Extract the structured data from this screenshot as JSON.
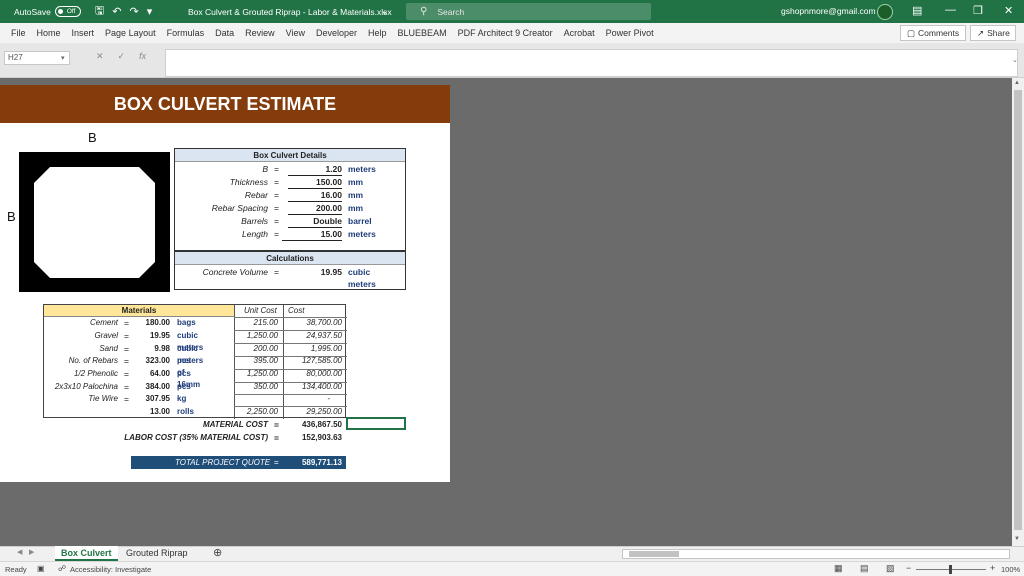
{
  "titlebar": {
    "autosave_label": "AutoSave",
    "autosave_state": "Off",
    "file_title": "Box Culvert & Grouted Riprap - Labor & Materials.xlsx",
    "search_placeholder": "Search",
    "user_email": "gshopnmore@gmail.com",
    "accent_color": "#217346"
  },
  "menu": {
    "items": [
      "File",
      "Home",
      "Insert",
      "Page Layout",
      "Formulas",
      "Data",
      "Review",
      "View",
      "Developer",
      "Help",
      "BLUEBEAM",
      "PDF Architect 9 Creator",
      "Acrobat",
      "Power Pivot"
    ],
    "comments_label": "Comments",
    "share_label": "Share"
  },
  "formula_bar": {
    "name_box": "H27",
    "fx_label": "fx",
    "value": ""
  },
  "sheet": {
    "title": "BOX CULVERT ESTIMATE",
    "title_color": "#843c0c",
    "diagram_label_top": "B",
    "diagram_label_left": "B",
    "details": {
      "header": "Box Culvert Details",
      "rows": [
        {
          "label": "B",
          "eq": "=",
          "value": "1.20",
          "unit": "meters"
        },
        {
          "label": "Thickness",
          "eq": "=",
          "value": "150.00",
          "unit": "mm"
        },
        {
          "label": "Rebar",
          "eq": "=",
          "value": "16.00",
          "unit": "mm"
        },
        {
          "label": "Rebar Spacing",
          "eq": "=",
          "value": "200.00",
          "unit": "mm"
        },
        {
          "label": "Barrels",
          "eq": "=",
          "value": "Double",
          "unit": "barrel"
        },
        {
          "label": "Length",
          "eq": "=",
          "value": "15.00",
          "unit": "meters"
        }
      ],
      "calc_header": "Calculations",
      "calc_label": "Concrete Volume",
      "calc_eq": "=",
      "calc_value": "19.95",
      "calc_unit": "cubic meters"
    },
    "materials": {
      "header": "Materials",
      "col_unit_cost": "Unit Cost",
      "col_cost": "Cost",
      "rows": [
        {
          "label": "Cement",
          "eq": "=",
          "qty": "180.00",
          "unit": "bags",
          "unit_cost": "215.00",
          "cost": "38,700.00"
        },
        {
          "label": "Gravel",
          "eq": "=",
          "qty": "19.95",
          "unit": "cubic meters",
          "unit_cost": "1,250.00",
          "cost": "24,937.50"
        },
        {
          "label": "Sand",
          "eq": "=",
          "qty": "9.98",
          "unit": "cubic meters",
          "unit_cost": "200.00",
          "cost": "1,995.00"
        },
        {
          "label": "No. of Rebars",
          "eq": "=",
          "qty": "323.00",
          "unit": "pcs of 16mm",
          "unit_cost": "395.00",
          "cost": "127,585.00"
        },
        {
          "label": "1/2 Phenolic",
          "eq": "=",
          "qty": "64.00",
          "unit": "pcs",
          "unit_cost": "1,250.00",
          "cost": "80,000.00"
        },
        {
          "label": "2x3x10 Palochina",
          "eq": "=",
          "qty": "384.00",
          "unit": "pcs",
          "unit_cost": "350.00",
          "cost": "134,400.00"
        },
        {
          "label": "Tie Wire",
          "eq": "=",
          "qty": "307.95",
          "unit": "kg",
          "unit_cost": "",
          "cost": "-"
        },
        {
          "label": "",
          "eq": "",
          "qty": "13.00",
          "unit": "rolls",
          "unit_cost": "2,250.00",
          "cost": "29,250.00"
        }
      ]
    },
    "material_cost_label": "MATERIAL COST",
    "material_cost_eq": "=",
    "material_cost_value": "436,867.50",
    "labor_cost_label": "LABOR COST  (35% MATERIAL COST)",
    "labor_cost_eq": "=",
    "labor_cost_value": "152,903.63",
    "quote_label": "TOTAL PROJECT QUOTE",
    "quote_eq": "=",
    "quote_value": "589,771.13",
    "quote_color": "#1f4e79"
  },
  "tabs": {
    "active": "Box Culvert",
    "other": "Grouted Riprap",
    "add_icon": "plus-circle-icon"
  },
  "status": {
    "ready": "Ready",
    "accessibility": "Accessibility: Investigate",
    "zoom": "100%"
  }
}
